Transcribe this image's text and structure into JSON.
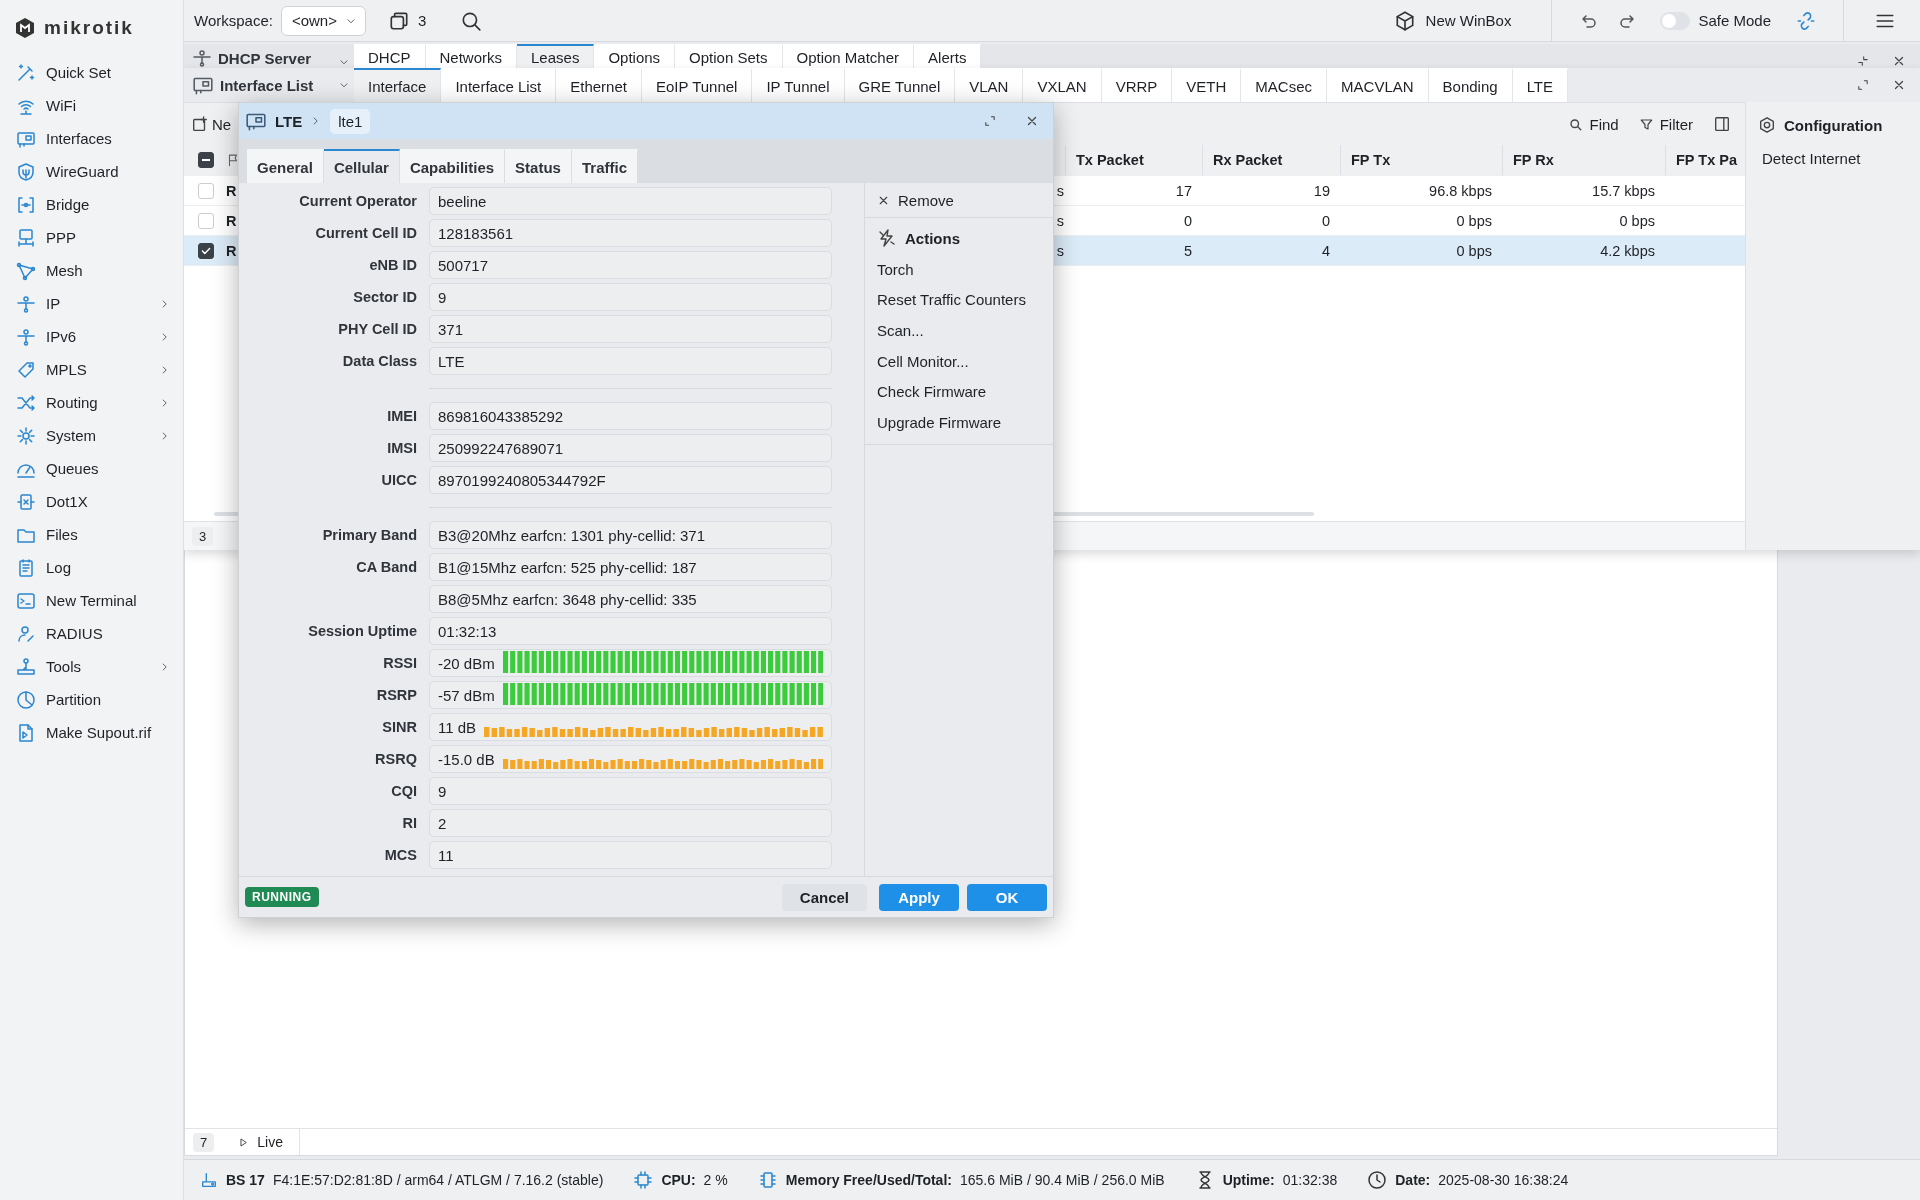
{
  "brand": {
    "name": "mikrotik"
  },
  "sidebar": {
    "items": [
      {
        "label": "Quick Set",
        "submenu": false
      },
      {
        "label": "WiFi",
        "submenu": false
      },
      {
        "label": "Interfaces",
        "submenu": false
      },
      {
        "label": "WireGuard",
        "submenu": false
      },
      {
        "label": "Bridge",
        "submenu": false
      },
      {
        "label": "PPP",
        "submenu": false
      },
      {
        "label": "Mesh",
        "submenu": false
      },
      {
        "label": "IP",
        "submenu": true
      },
      {
        "label": "IPv6",
        "submenu": true
      },
      {
        "label": "MPLS",
        "submenu": true
      },
      {
        "label": "Routing",
        "submenu": true
      },
      {
        "label": "System",
        "submenu": true
      },
      {
        "label": "Queues",
        "submenu": false
      },
      {
        "label": "Dot1X",
        "submenu": false
      },
      {
        "label": "Files",
        "submenu": false
      },
      {
        "label": "Log",
        "submenu": false
      },
      {
        "label": "New Terminal",
        "submenu": false
      },
      {
        "label": "RADIUS",
        "submenu": false
      },
      {
        "label": "Tools",
        "submenu": true
      },
      {
        "label": "Partition",
        "submenu": false
      },
      {
        "label": "Make Supout.rif",
        "submenu": false
      }
    ]
  },
  "topbar": {
    "workspace_label": "Workspace:",
    "workspace_value": "<own>",
    "windows_count": "3",
    "new_winbox": "New WinBox",
    "safe_mode": {
      "label": "Safe Mode",
      "on": false
    }
  },
  "dhcp_window": {
    "title": "DHCP Server",
    "tabs": [
      {
        "label": "DHCP",
        "selected": false
      },
      {
        "label": "Networks",
        "selected": false
      },
      {
        "label": "Leases",
        "selected": true
      },
      {
        "label": "Options",
        "selected": false
      },
      {
        "label": "Option Sets",
        "selected": false
      },
      {
        "label": "Option Matcher",
        "selected": false
      },
      {
        "label": "Alerts",
        "selected": false
      }
    ]
  },
  "interface_window": {
    "title": "Interface List",
    "tabs": [
      {
        "label": "Interface",
        "selected": true
      },
      {
        "label": "Interface List",
        "selected": false
      },
      {
        "label": "Ethernet",
        "selected": false
      },
      {
        "label": "EoIP Tunnel",
        "selected": false
      },
      {
        "label": "IP Tunnel",
        "selected": false
      },
      {
        "label": "GRE Tunnel",
        "selected": false
      },
      {
        "label": "VLAN",
        "selected": false
      },
      {
        "label": "VXLAN",
        "selected": false
      },
      {
        "label": "VRRP",
        "selected": false
      },
      {
        "label": "VETH",
        "selected": false
      },
      {
        "label": "MACsec",
        "selected": false
      },
      {
        "label": "MACVLAN",
        "selected": false
      },
      {
        "label": "Bonding",
        "selected": false
      },
      {
        "label": "LTE",
        "selected": false
      }
    ],
    "toolbar": {
      "new": "Ne",
      "find": "Find",
      "filter": "Filter"
    },
    "table": {
      "select_all_indeterminate": true,
      "columns": [
        "Tx Packet",
        "Rx Packet",
        "FP Tx",
        "FP Rx",
        "FP Tx Pa"
      ],
      "rows": [
        {
          "checked": false,
          "selected": false,
          "cells": [
            "R",
            "s",
            "17",
            "19",
            "96.8 kbps",
            "15.7 kbps"
          ]
        },
        {
          "checked": false,
          "selected": false,
          "cells": [
            "R",
            "s",
            "0",
            "0",
            "0 bps",
            "0 bps"
          ]
        },
        {
          "checked": true,
          "selected": true,
          "cells": [
            "R",
            "s",
            "5",
            "4",
            "0 bps",
            "4.2 kbps"
          ]
        }
      ]
    },
    "count": "3",
    "side_panel": {
      "title": "Configuration",
      "items": [
        "Detect Internet"
      ]
    }
  },
  "lte_dialog": {
    "section": "LTE",
    "name": "lte1",
    "tabs": [
      {
        "label": "General",
        "selected": false
      },
      {
        "label": "Cellular",
        "selected": true
      },
      {
        "label": "Capabilities",
        "selected": false
      },
      {
        "label": "Status",
        "selected": false
      },
      {
        "label": "Traffic",
        "selected": false
      }
    ],
    "fields": [
      {
        "kind": "text",
        "label": "Current Operator",
        "value": "beeline"
      },
      {
        "kind": "text",
        "label": "Current Cell ID",
        "value": "128183561"
      },
      {
        "kind": "text",
        "label": "eNB ID",
        "value": "500717"
      },
      {
        "kind": "text",
        "label": "Sector ID",
        "value": "9"
      },
      {
        "kind": "text",
        "label": "PHY Cell ID",
        "value": "371"
      },
      {
        "kind": "text",
        "label": "Data Class",
        "value": "LTE"
      },
      {
        "kind": "separator"
      },
      {
        "kind": "text",
        "label": "IMEI",
        "value": "869816043385292"
      },
      {
        "kind": "text",
        "label": "IMSI",
        "value": "250992247689071"
      },
      {
        "kind": "text",
        "label": "UICC",
        "value": "8970199240805344792F"
      },
      {
        "kind": "separator"
      },
      {
        "kind": "text",
        "label": "Primary Band",
        "value": "B3@20Mhz earfcn: 1301 phy-cellid: 371"
      },
      {
        "kind": "text",
        "label": "CA Band",
        "value": "B1@15Mhz earfcn: 525 phy-cellid: 187"
      },
      {
        "kind": "text",
        "value": "B8@5Mhz earfcn: 3648 phy-cellid: 335"
      },
      {
        "kind": "text",
        "label": "Session Uptime",
        "value": "01:32:13"
      },
      {
        "kind": "signal",
        "label": "RSSI",
        "value": "-20 dBm",
        "strong": true,
        "color": "#3ccb3c"
      },
      {
        "kind": "signal",
        "label": "RSRP",
        "value": "-57 dBm",
        "strong": true,
        "color": "#3ccb3c"
      },
      {
        "kind": "signal",
        "label": "SINR",
        "value": "11 dB",
        "strong": false,
        "color": "#f5a623"
      },
      {
        "kind": "signal",
        "label": "RSRQ",
        "value": "-15.0 dB",
        "strong": false,
        "color": "#f5a623"
      },
      {
        "kind": "text",
        "label": "CQI",
        "value": "9"
      },
      {
        "kind": "text",
        "label": "RI",
        "value": "2"
      },
      {
        "kind": "text",
        "label": "MCS",
        "value": "11"
      }
    ],
    "remove": "Remove",
    "actions": {
      "title": "Actions",
      "items": [
        "Torch",
        "Reset Traffic Counters",
        "Scan...",
        "Cell Monitor...",
        "Check Firmware",
        "Upgrade Firmware"
      ]
    },
    "status": "RUNNING",
    "buttons": [
      {
        "label": "Cancel",
        "kind": "secondary"
      },
      {
        "label": "Apply",
        "kind": "primary"
      },
      {
        "label": "OK",
        "kind": "primary"
      }
    ]
  },
  "background_window": {
    "count": "7",
    "live": "Live"
  },
  "status_bar": {
    "board": "BS 17",
    "info": "F4:1E:57:D2:81:8D / arm64 / ATLGM / 7.16.2 (stable)",
    "cpu_label": "CPU:",
    "cpu": "2 %",
    "memory_label": "Memory Free/Used/Total:",
    "memory": "165.6 MiB / 90.4 MiB / 256.0 MiB",
    "uptime_label": "Uptime:",
    "uptime": "01:32:38",
    "date_label": "Date:",
    "date": "2025-08-30 16:38:24"
  }
}
